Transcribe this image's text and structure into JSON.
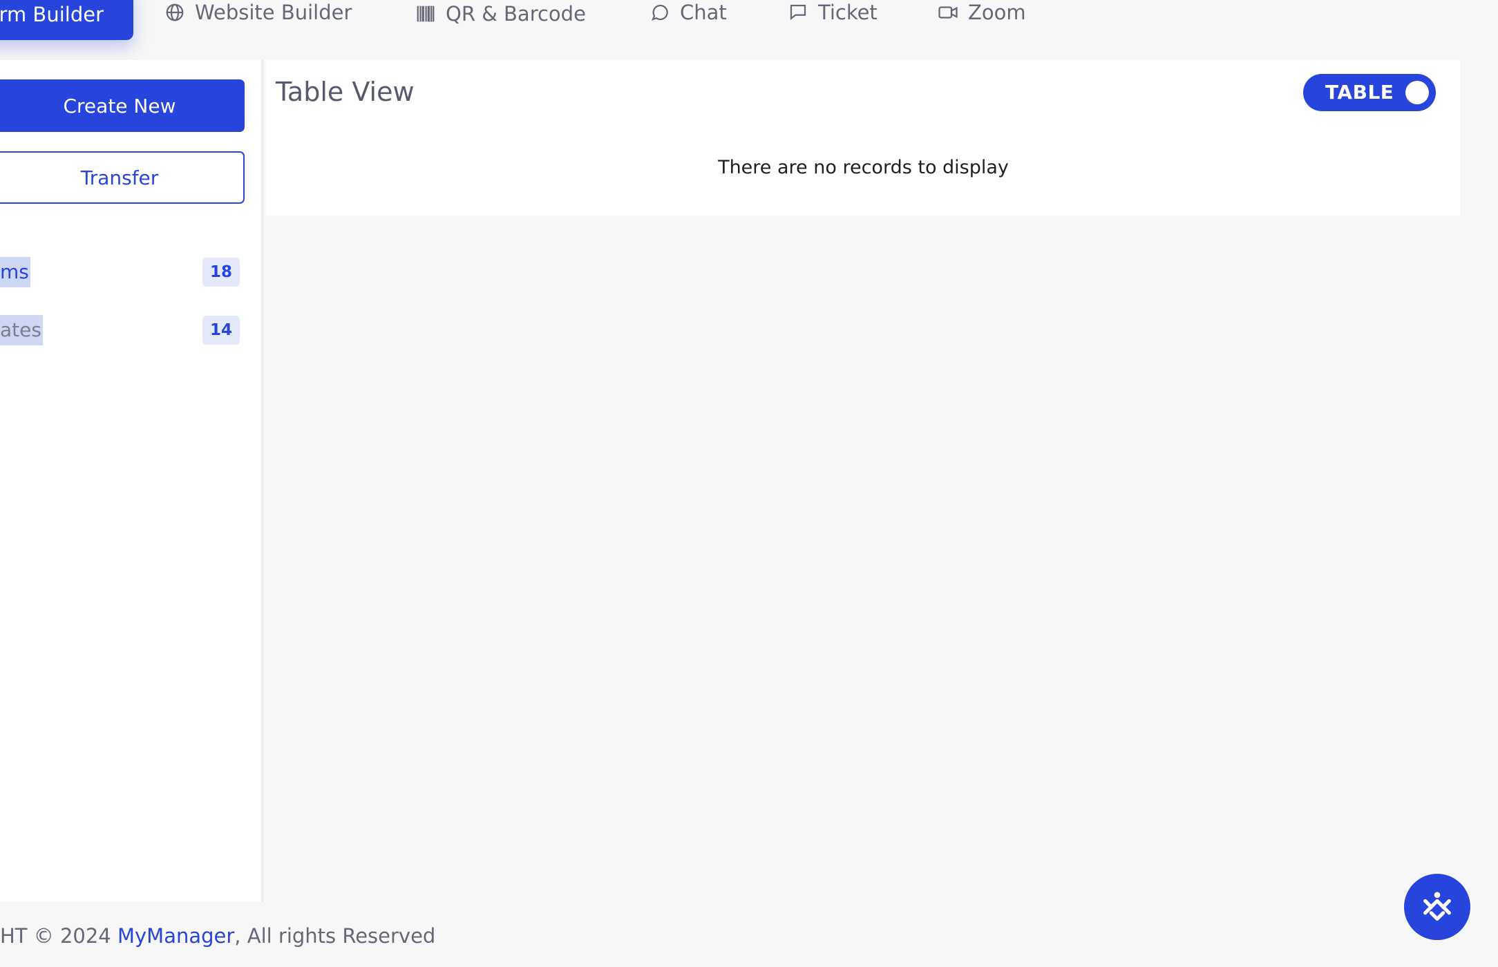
{
  "nav": {
    "active_label": "rm Builder",
    "items": [
      {
        "label": "Website Builder",
        "icon": "globe-icon"
      },
      {
        "label": "QR & Barcode",
        "icon": "barcode-icon"
      },
      {
        "label": "Chat",
        "icon": "chat-icon"
      },
      {
        "label": "Ticket",
        "icon": "ticket-icon"
      },
      {
        "label": "Zoom",
        "icon": "video-camera-icon"
      }
    ]
  },
  "sidebar": {
    "create_label": "Create New",
    "transfer_label": "Transfer",
    "items": [
      {
        "label": "ms",
        "count": "18"
      },
      {
        "label": "ates",
        "count": "14"
      }
    ]
  },
  "main": {
    "title": "Table View",
    "toggle_label": "TABLE",
    "empty_message": "There are no records to display"
  },
  "footer": {
    "prefix": "HT © 2024 ",
    "brand": "MyManager",
    "suffix": ", All rights Reserved"
  },
  "colors": {
    "accent": "#2744dd",
    "background": "#f7f7f7",
    "selection": "#cdd7f3"
  },
  "fab": {
    "icon": "mymanager-logo-icon"
  }
}
